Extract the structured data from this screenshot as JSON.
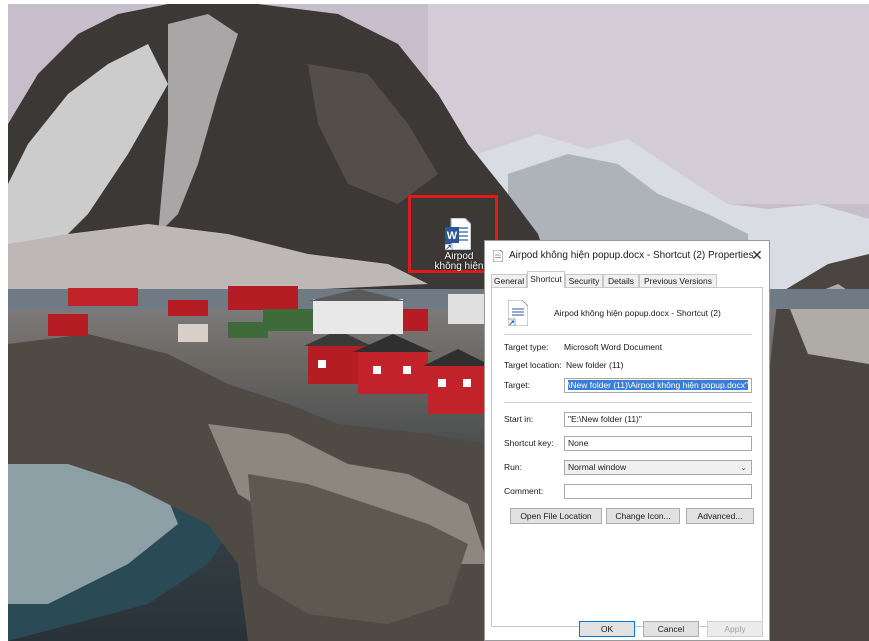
{
  "desktop": {
    "icon_label": "Airpod\nkhông hiện"
  },
  "dialog": {
    "title": "Airpod không hiện popup.docx - Shortcut (2) Properties",
    "close_glyph": "✕",
    "tabs": [
      "General",
      "Shortcut",
      "Security",
      "Details",
      "Previous Versions"
    ],
    "active_tab": "Shortcut",
    "shortcut_name": "Airpod không hiện popup.docx - Shortcut (2)",
    "target_type_label": "Target type:",
    "target_type_value": "Microsoft Word Document",
    "target_location_label": "Target location:",
    "target_location_value": "New folder (11)",
    "target_label": "Target:",
    "target_value": "\\New folder (11)\\Airpod không hiện popup.docx\"",
    "start_in_label": "Start in:",
    "start_in_value": "\"E:\\New folder (11)\"",
    "shortcut_key_label": "Shortcut key:",
    "shortcut_key_value": "None",
    "run_label": "Run:",
    "run_value": "Normal window",
    "comment_label": "Comment:",
    "comment_value": "",
    "open_file_location_label": "Open File Location",
    "change_icon_label": "Change Icon...",
    "advanced_label": "Advanced...",
    "ok_label": "OK",
    "cancel_label": "Cancel",
    "apply_label": "Apply"
  },
  "colors": {
    "highlight_box": "#e01b1b",
    "selection": "#3a7ed8",
    "word_blue": "#2b5797"
  }
}
